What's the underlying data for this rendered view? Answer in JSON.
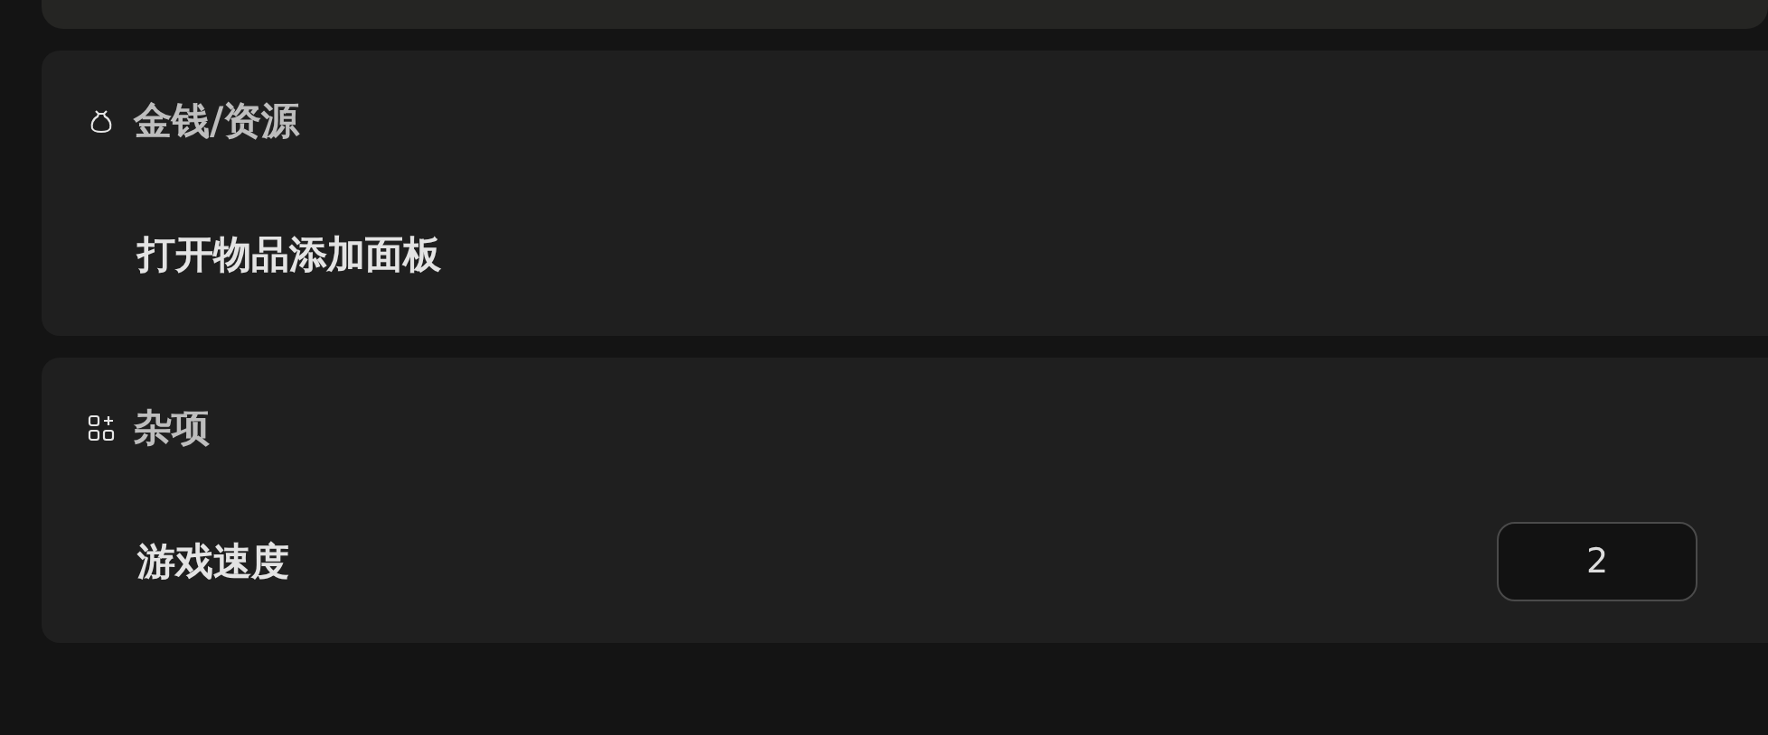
{
  "sections": [
    {
      "kind": "bag",
      "title": "金钱/资源",
      "rows": [
        {
          "kind": "action",
          "label": "打开物品添加面板"
        }
      ]
    },
    {
      "kind": "apps",
      "title": "杂项",
      "rows": [
        {
          "kind": "number",
          "label": "游戏速度",
          "value": "2"
        }
      ]
    }
  ]
}
